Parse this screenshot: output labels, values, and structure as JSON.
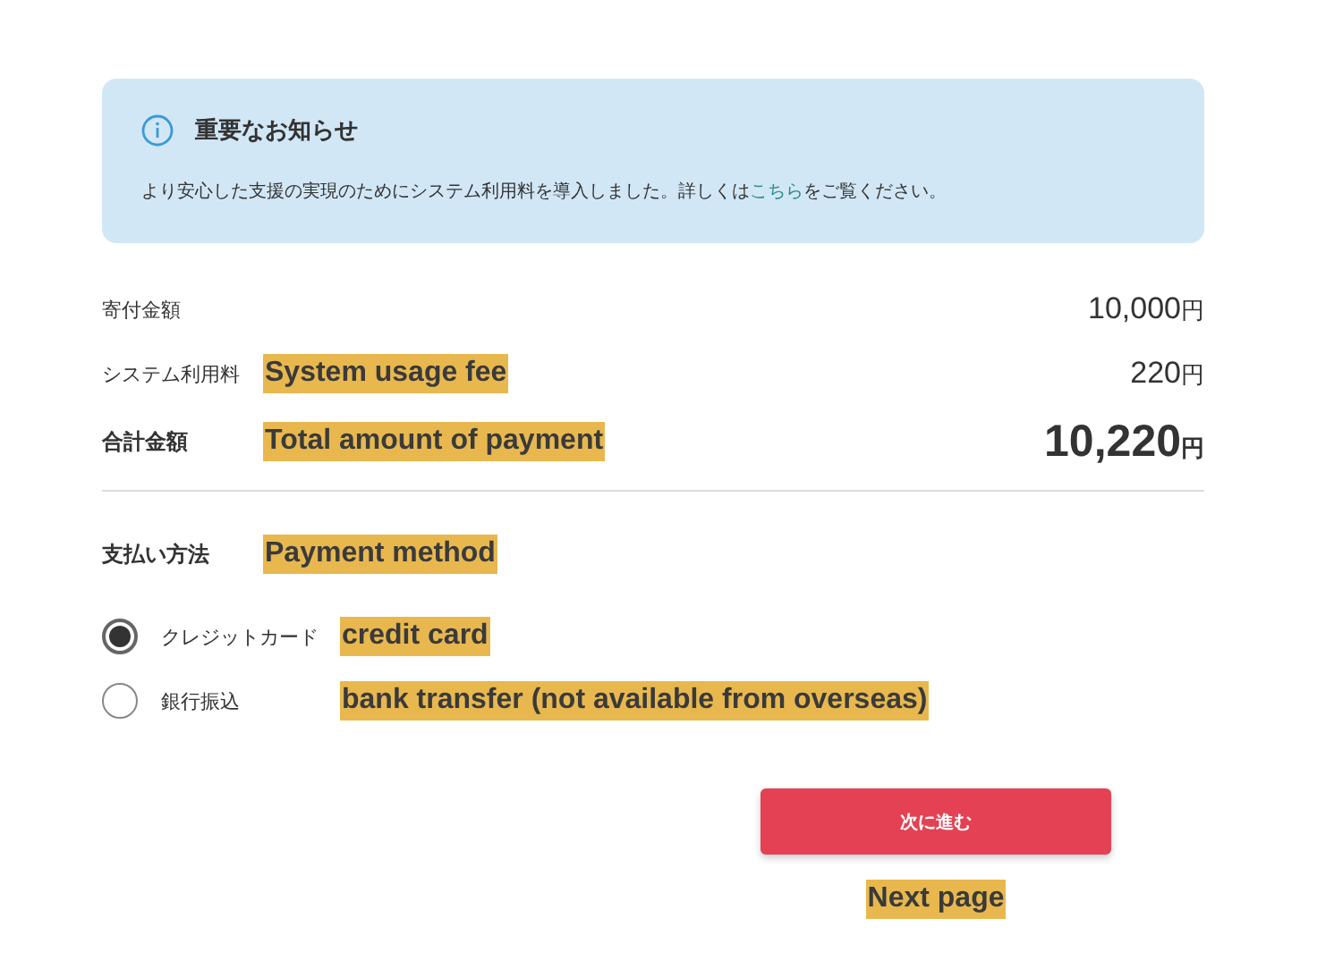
{
  "notice": {
    "title": "重要なお知らせ",
    "text_before": "より安心した支援の実現のためにシステム利用料を導入しました。詳しくは",
    "link": "こちら",
    "text_after": "をご覧ください。"
  },
  "amounts": [
    {
      "label": "寄付金額",
      "value": "10,000",
      "unit": "円",
      "kind": "normal"
    },
    {
      "label": "システム利用料",
      "note": "System usage fee",
      "value": "220",
      "unit": "円",
      "kind": "normal"
    },
    {
      "label": "合計金額",
      "note": "Total amount of payment",
      "value": "10,220",
      "unit": "円",
      "kind": "total"
    }
  ],
  "payment": {
    "label": "支払い方法",
    "note": "Payment method",
    "options": [
      {
        "label": "クレジットカード",
        "note": "credit card",
        "selected": true
      },
      {
        "label": "銀行振込",
        "note": "bank transfer (not available from overseas)",
        "selected": false
      }
    ]
  },
  "next_button": {
    "label": "次に進む",
    "note": "Next page"
  }
}
